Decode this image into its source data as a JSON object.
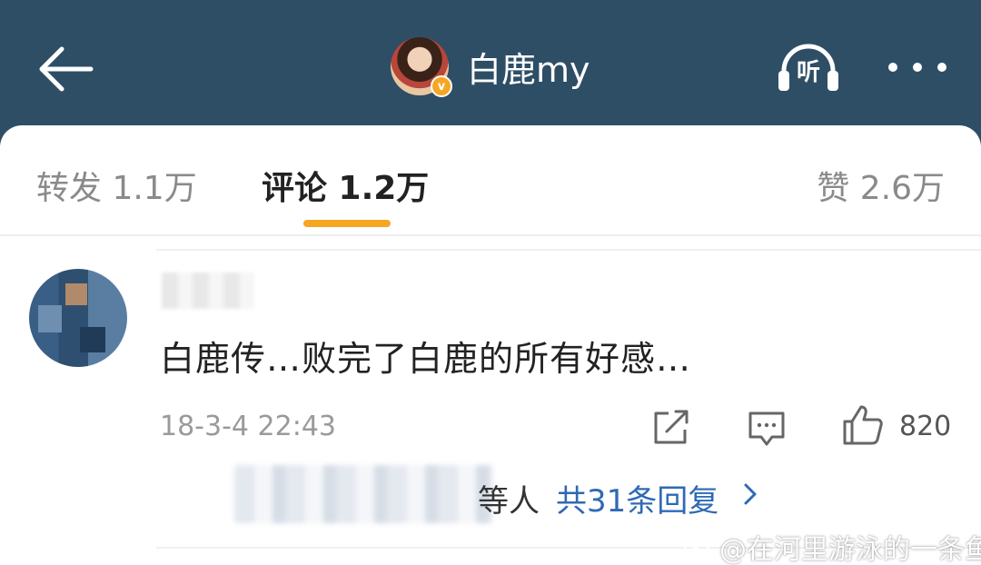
{
  "header": {
    "title": "白鹿my",
    "verified_badge": "v",
    "listen_label": "听"
  },
  "tabs": [
    {
      "label": "转发 1.1万"
    },
    {
      "label": "评论 1.2万"
    },
    {
      "label": "赞 2.6万"
    }
  ],
  "comment": {
    "text": "白鹿传…败完了白鹿的所有好感…",
    "time": "18-3-4 22:43",
    "like_count": "820",
    "sub_reply_suffix": "等人",
    "sub_reply_link": "共31条回复"
  },
  "watermark": {
    "text": "@在河里游泳的一条鱼"
  },
  "colors": {
    "header_bg": "#2e4e66",
    "tab_accent": "#f5a623",
    "link_blue": "#2f6ab3"
  },
  "icons": [
    "back-arrow-icon",
    "listen-icon",
    "more-dots-icon",
    "share-icon",
    "reply-icon",
    "like-thumb-icon",
    "chevron-right-icon",
    "weibo-icon"
  ]
}
